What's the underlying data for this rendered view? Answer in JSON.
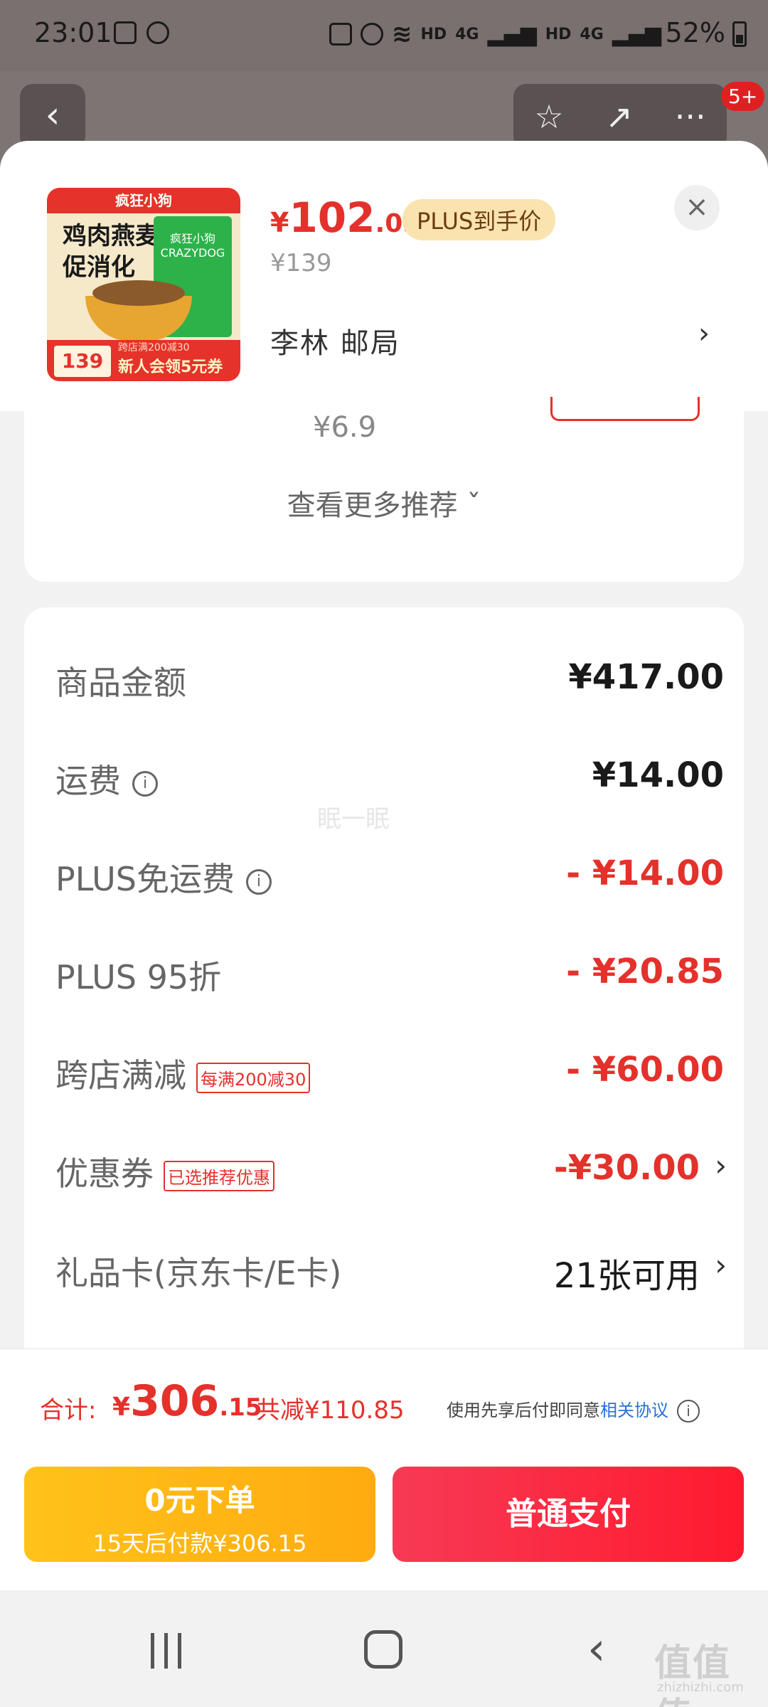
{
  "status_bar": {
    "time": "23:01",
    "net_labels": [
      "HD",
      "4G",
      "HD",
      "4G"
    ],
    "battery": "52%"
  },
  "nav": {
    "back_icon": "‹",
    "star_icon": "☆",
    "share_icon": "↗",
    "more_icon": "···",
    "badge": "5+"
  },
  "product": {
    "thumb": {
      "brand_top": "疯狂小狗",
      "title_line1": "鸡肉燕麦",
      "title_line2": "促消化",
      "bag_brand": "疯狂小狗 CRAZYDOG",
      "price_badge": "139",
      "promo_small": "跨店满200减30",
      "promo_text": "新人会领5元券"
    },
    "price_yen": "¥",
    "price_int": "102",
    "price_dec": ".05",
    "plus_tag": "PLUS到手价",
    "original_price": "¥139",
    "address": "李林  邮局",
    "close_icon": "×",
    "chevron": "›"
  },
  "recommend": {
    "price": "¥6.9",
    "more_label": "查看更多推荐 ˇ"
  },
  "summary": {
    "rows": [
      {
        "label": "商品金额",
        "amount": "¥417.00"
      },
      {
        "label": "运费",
        "amount": "¥14.00"
      },
      {
        "label": "PLUS免运费",
        "amount": "- ¥14.00"
      },
      {
        "label": "PLUS 95折",
        "amount": "- ¥20.85"
      },
      {
        "label": "跨店满减",
        "tag": "每满200减30",
        "amount": "- ¥60.00"
      },
      {
        "label": "优惠券",
        "tag": "已选推荐优惠",
        "amount": "-¥30.00"
      },
      {
        "label": "礼品卡(京东卡/E卡)",
        "amount": "21张可用"
      }
    ],
    "info_icon": "i",
    "chevron": "›",
    "overlay_text": "眠一眠"
  },
  "footer": {
    "total_label": "合计:",
    "total_yen": "¥",
    "total_int": "306",
    "total_dec": ".15",
    "saved": "共减¥110.85",
    "agreement_prefix": "使用先享后付即同意",
    "agreement_link": "相关协议",
    "zero_pay_line1": "0元下单",
    "zero_pay_line2": "15天后付款¥306.15",
    "normal_pay": "普通支付"
  },
  "watermark": {
    "main": "值值值",
    "sub": "zhizhizhi.com"
  },
  "colors": {
    "accent_red": "#e4312b",
    "pay_red": "#ff1a2e",
    "zero_pay_yellow": "#ffb514",
    "link_blue": "#2a6fd6"
  }
}
